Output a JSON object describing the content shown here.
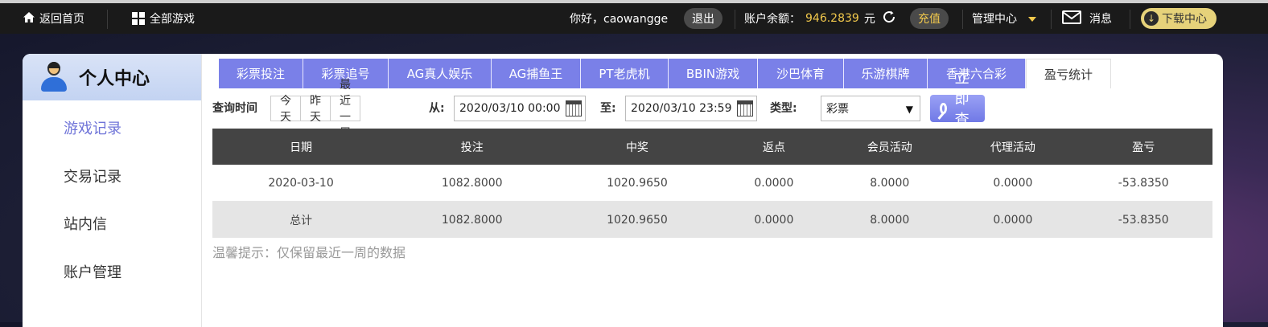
{
  "topbar": {
    "home_label": "返回首页",
    "all_games_label": "全部游戏",
    "greeting": "你好，caowangge",
    "logout_label": "退出",
    "balance_label": "账户余额：",
    "balance_value": "946.2839",
    "balance_unit": "元",
    "recharge_label": "充值",
    "manage_label": "管理中心",
    "message_label": "消息",
    "download_label": "下载中心"
  },
  "sidebar": {
    "title": "个人中心",
    "items": [
      {
        "label": "游戏记录"
      },
      {
        "label": "交易记录"
      },
      {
        "label": "站内信"
      },
      {
        "label": "账户管理"
      }
    ]
  },
  "tabs": [
    {
      "label": "彩票投注"
    },
    {
      "label": "彩票追号"
    },
    {
      "label": "AG真人娱乐"
    },
    {
      "label": "AG捕鱼王"
    },
    {
      "label": "PT老虎机"
    },
    {
      "label": "BBIN游戏"
    },
    {
      "label": "沙巴体育"
    },
    {
      "label": "乐游棋牌"
    },
    {
      "label": "香港六合彩"
    },
    {
      "label": "盈亏统计"
    }
  ],
  "filter": {
    "query_time_label": "查询时间",
    "quick": [
      "今天",
      "昨天",
      "最近一周"
    ],
    "from_label": "从:",
    "from_value": "2020/03/10 00:00",
    "to_label": "至:",
    "to_value": "2020/03/10 23:59",
    "type_label": "类型:",
    "type_value": "彩票",
    "query_button": "立即查询"
  },
  "table": {
    "headers": [
      "日期",
      "投注",
      "中奖",
      "返点",
      "会员活动",
      "代理活动",
      "盈亏"
    ],
    "rows": [
      [
        "2020-03-10",
        "1082.8000",
        "1020.9650",
        "0.0000",
        "8.0000",
        "0.0000",
        "-53.8350"
      ],
      [
        "总计",
        "1082.8000",
        "1020.9650",
        "0.0000",
        "8.0000",
        "0.0000",
        "-53.8350"
      ]
    ]
  },
  "tip": "温馨提示：仅保留最近一周的数据"
}
